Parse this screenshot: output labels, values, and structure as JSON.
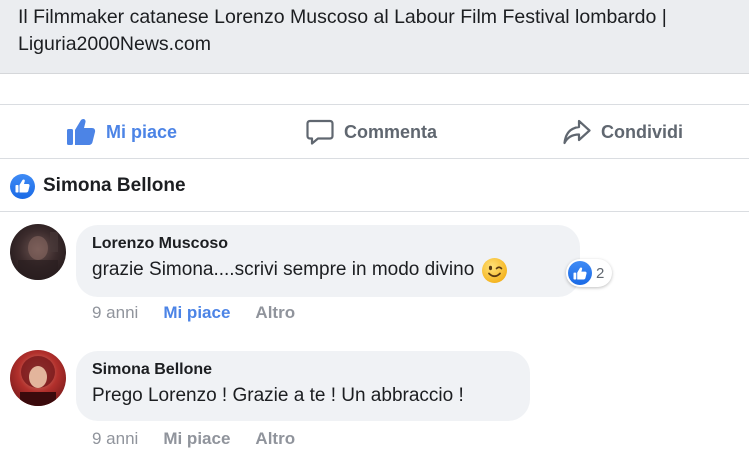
{
  "link_preview": {
    "title": "Il Filmmaker catanese Lorenzo Muscoso al Labour Film Festival lombardo | Liguria2000News.com"
  },
  "actions": {
    "like_label": "Mi piace",
    "comment_label": "Commenta",
    "share_label": "Condividi"
  },
  "likers": {
    "name": "Simona Bellone"
  },
  "comments": [
    {
      "author": "Lorenzo Muscoso",
      "text": "grazie Simona....scrivi sempre in modo divino",
      "emoji": "wink-emoji",
      "reaction_count": "2",
      "time": "9 anni",
      "like_label": "Mi piace",
      "more_label": "Altro",
      "liked": true
    },
    {
      "author": "Simona Bellone",
      "text": "Prego Lorenzo ! Grazie a te ! Un abbraccio !",
      "time": "9 anni",
      "like_label": "Mi piace",
      "more_label": "Altro",
      "liked": false
    }
  ],
  "colors": {
    "accent": "#4c84e6",
    "secondary_text": "#90949c",
    "bubble": "#f0f2f5"
  }
}
